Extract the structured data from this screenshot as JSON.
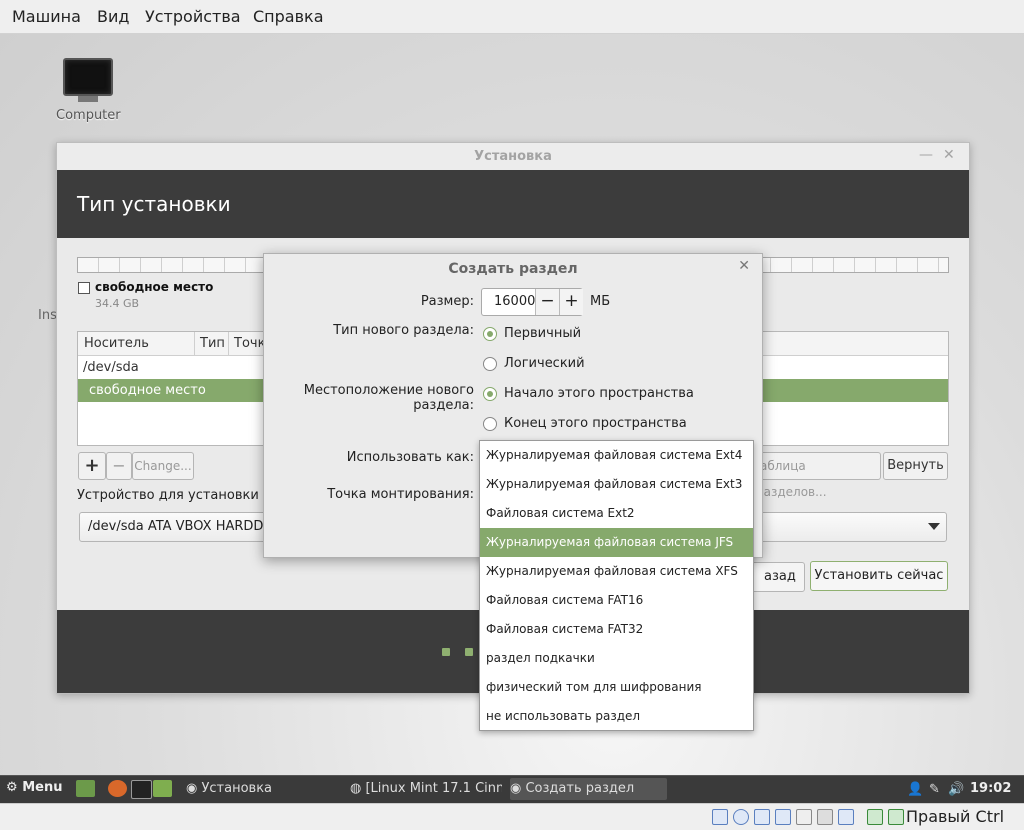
{
  "vbox": {
    "menu": [
      "Машина",
      "Вид",
      "Устройства",
      "Справка"
    ],
    "host_key": "Правый Ctrl"
  },
  "desktop": {
    "icon_label": "Computer",
    "clipped_text": "Ins"
  },
  "installer": {
    "window_title": "Установка",
    "header": "Тип установки",
    "legend_label": "свободное место",
    "legend_size": "34.4 GB",
    "table_headers": [
      "Носитель",
      "Тип",
      "Точка"
    ],
    "rows": [
      {
        "device": "/dev/sda",
        "selected": false
      },
      {
        "device": "свободное место",
        "selected": true
      }
    ],
    "add_label": "+",
    "remove_label": "−",
    "change_label": "Change...",
    "table_button_label": "аблица разделов...",
    "revert_label": "Вернуть",
    "device_label": "Устройство для установки сист",
    "device_value": "/dev/sda ATA VBOX HARDDISK (",
    "back_label": "азад",
    "install_label": "Установить сейчас"
  },
  "dialog": {
    "title": "Создать раздел",
    "size_label": "Размер:",
    "size_value": "16000",
    "minus": "−",
    "plus": "+",
    "unit": "МБ",
    "type_label": "Тип нового раздела:",
    "type_primary": "Первичный",
    "type_logical": "Логический",
    "location_label": "Местоположение нового раздела:",
    "loc_start": "Начало этого пространства",
    "loc_end": "Конец этого пространства",
    "use_as_label": "Использовать как:",
    "mount_label": "Точка монтирования:"
  },
  "dropdown": {
    "options": [
      "Журналируемая файловая система Ext4",
      "Журналируемая файловая система Ext3",
      "Файловая система Ext2",
      "Журналируемая файловая система JFS",
      "Журналируемая файловая система XFS",
      "Файловая система FAT16",
      "Файловая система FAT32",
      "раздел подкачки",
      "физический том для шифрования",
      "не использовать раздел"
    ],
    "selected_index": 3
  },
  "taskbar": {
    "menu_label": "Menu",
    "tasks": [
      "Установка",
      "[Linux Mint 17.1 Cinn...",
      "Создать раздел"
    ],
    "active_task_index": 2,
    "clock": "19:02"
  },
  "colors": {
    "accent": "#86a96c",
    "header_bg": "#3c3c3c"
  }
}
